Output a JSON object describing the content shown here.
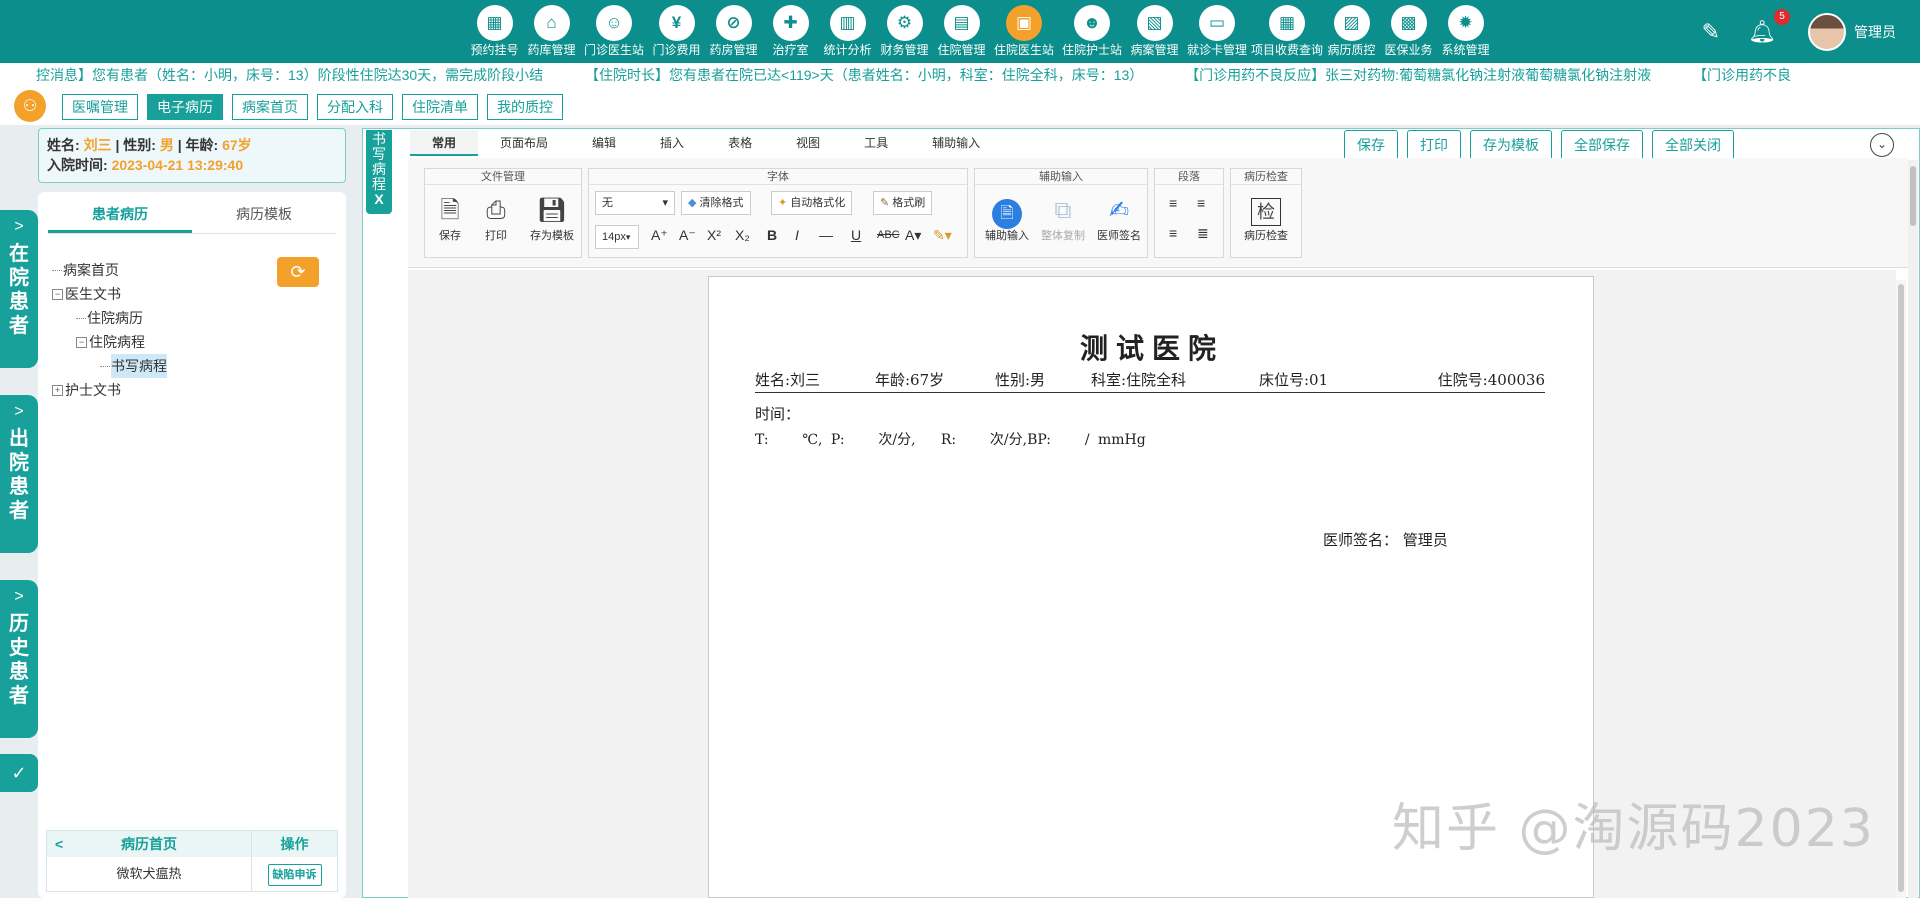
{
  "header": {
    "nav": [
      {
        "label": "预约挂号",
        "icon": "calendar-icon",
        "glyph": "▦"
      },
      {
        "label": "药库管理",
        "icon": "warehouse-icon",
        "glyph": "⌂"
      },
      {
        "label": "门诊医生站",
        "icon": "doctor-icon",
        "glyph": "☺"
      },
      {
        "label": "门诊费用",
        "icon": "yen-icon",
        "glyph": "¥"
      },
      {
        "label": "药房管理",
        "icon": "pill-icon",
        "glyph": "⊘"
      },
      {
        "label": "治疗室",
        "icon": "nurse-icon",
        "glyph": "✚"
      },
      {
        "label": "统计分析",
        "icon": "bar-chart-icon",
        "glyph": "▥"
      },
      {
        "label": "财务管理",
        "icon": "gear-icon",
        "glyph": "⚙"
      },
      {
        "label": "住院管理",
        "icon": "bed-icon",
        "glyph": "▤"
      },
      {
        "label": "住院医生站",
        "icon": "inpatient-doctor-icon",
        "glyph": "▣",
        "active": true
      },
      {
        "label": "住院护士站",
        "icon": "nurse-station-icon",
        "glyph": "☻"
      },
      {
        "label": "病案管理",
        "icon": "record-icon",
        "glyph": "▧"
      },
      {
        "label": "就诊卡管理",
        "icon": "card-icon",
        "glyph": "▭"
      },
      {
        "label": "项目收费查询",
        "icon": "billing-icon",
        "glyph": "▦"
      },
      {
        "label": "病历质控",
        "icon": "quality-icon",
        "glyph": "▨"
      },
      {
        "label": "医保业务",
        "icon": "insurance-icon",
        "glyph": "▩"
      },
      {
        "label": "系统管理",
        "icon": "settings-icon",
        "glyph": "✹"
      }
    ],
    "notification_count": "5",
    "username": "管理员"
  },
  "ticker": [
    "控消息】您有患者（姓名：小明，床号：13）阶段性住院达30天，需完成阶段小结",
    "【住院时长】您有患者在院已达<119>天（患者姓名：小明，科室：住院全科，床号：13）",
    "【门诊用药不良反应】张三对药物:葡萄糖氯化钠注射液葡萄糖氯化钠注射液",
    "【门诊用药不良"
  ],
  "subtabs": [
    "医嘱管理",
    "电子病历",
    "病案首页",
    "分配入科",
    "住院清单",
    "我的质控"
  ],
  "side_tabs": [
    "在院患者",
    "出院患者",
    "历史患者"
  ],
  "patient": {
    "name_label": "姓名:",
    "name": "刘三",
    "gender_label": "| 性别:",
    "gender": "男",
    "age_label": "| 年龄:",
    "age": "67岁",
    "admit_label": "入院时间:",
    "admit_time": "2023-04-21 13:29:40"
  },
  "left_panel": {
    "tabs": [
      "患者病历",
      "病历模板"
    ],
    "tree": [
      {
        "label": "病案首页",
        "level": 0,
        "toggle": ""
      },
      {
        "label": "医生文书",
        "level": 0,
        "toggle": "−"
      },
      {
        "label": "住院病历",
        "level": 1,
        "toggle": ""
      },
      {
        "label": "住院病程",
        "level": 1,
        "toggle": "−"
      },
      {
        "label": "书写病程",
        "level": 2,
        "toggle": "",
        "selected": true
      },
      {
        "label": "护士文书",
        "level": 0,
        "toggle": "+"
      }
    ],
    "table": {
      "col1": "病历首页",
      "col2": "操作",
      "row_name": "微软犬瘟热",
      "row_action": "缺陷申诉"
    }
  },
  "editor": {
    "side_label": "书写病程",
    "side_close": "X",
    "ribbon_tabs": [
      "常用",
      "页面布局",
      "编辑",
      "插入",
      "表格",
      "视图",
      "工具",
      "辅助输入"
    ],
    "top_buttons": [
      "保存",
      "打印",
      "存为模板",
      "全部保存",
      "全部关闭"
    ],
    "groups": {
      "file": {
        "title": "文件管理",
        "buttons": [
          "保存",
          "打印",
          "存为模板"
        ]
      },
      "font": {
        "title": "字体",
        "font_name": "无",
        "font_size": "14px",
        "clear": "清除格式",
        "auto": "自动格式化",
        "brush": "格式刷"
      },
      "assist": {
        "title": "辅助输入",
        "buttons": [
          "辅助输入",
          "整体复制",
          "医师签名"
        ]
      },
      "para": {
        "title": "段落"
      },
      "check": {
        "title": "病历检查",
        "glyph": "检",
        "button": "病历检查"
      }
    },
    "document": {
      "hospital": "测试医院",
      "name": "姓名:刘三",
      "age": "年龄:67岁",
      "gender": "性别:男",
      "dept": "科室:住院全科",
      "bed": "床位号:01",
      "inpatient_no": "住院号:400036",
      "time_label": "时间：",
      "vitals": "T:    ℃, P:    次/分,   R:    次/分,BP:    / mmHg",
      "signature": "医师签名：  管理员"
    }
  },
  "watermark": "知乎 @淘源码2023"
}
